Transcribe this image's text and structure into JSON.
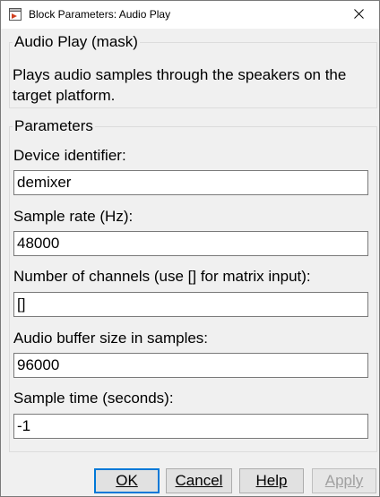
{
  "window": {
    "title": "Block Parameters: Audio Play"
  },
  "mask": {
    "label": "Audio Play (mask)",
    "description": "Plays audio samples through the speakers on the target platform."
  },
  "parameters": {
    "label": "Parameters",
    "fields": [
      {
        "label": "Device identifier:",
        "value": "demixer"
      },
      {
        "label": "Sample rate (Hz):",
        "value": "48000"
      },
      {
        "label": "Number of channels (use [] for matrix input):",
        "value": "[]"
      },
      {
        "label": "Audio buffer size in samples:",
        "value": "96000"
      },
      {
        "label": "Sample time (seconds):",
        "value": "-1"
      }
    ]
  },
  "buttons": {
    "ok": "OK",
    "cancel": "Cancel",
    "help": "Help",
    "apply": "Apply"
  },
  "icons": {
    "app": "block-icon",
    "close": "close-icon"
  },
  "colors": {
    "default_button_border": "#0078d7",
    "disabled_text": "#a0a0a0"
  }
}
